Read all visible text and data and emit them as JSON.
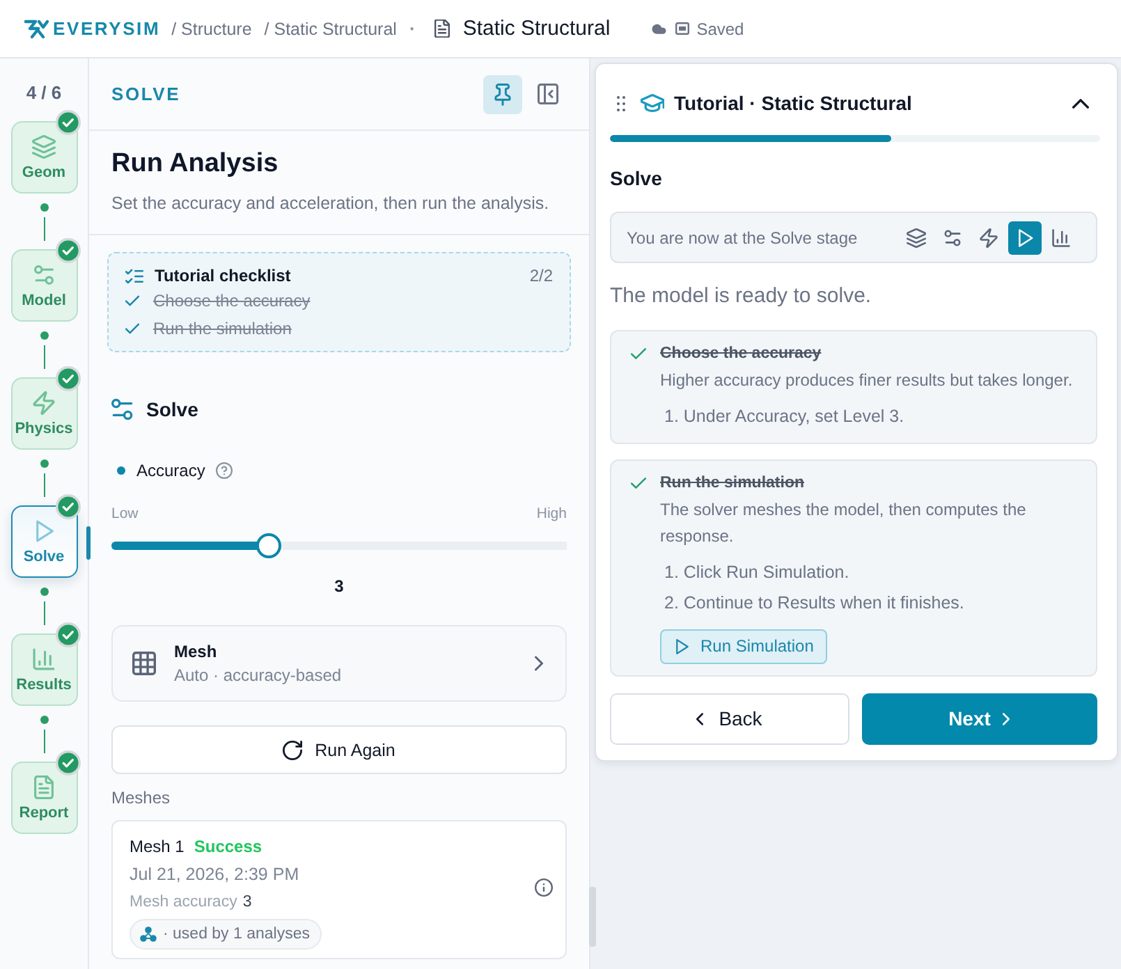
{
  "top_bar": {
    "logo": "EVERYSIM",
    "breadcrumbs": [
      "/ Structure",
      "/ Static Structural"
    ],
    "separator": "·",
    "document_title": "Static Structural",
    "save_status": "Saved"
  },
  "step_rail": {
    "progress": "4 / 6",
    "steps": [
      {
        "label": "Geom",
        "kind": "layers",
        "done": true,
        "selected": false
      },
      {
        "label": "Model",
        "kind": "sliders",
        "done": true,
        "selected": false
      },
      {
        "label": "Physics",
        "kind": "bolt",
        "done": true,
        "selected": false
      },
      {
        "label": "Solve",
        "kind": "play",
        "done": true,
        "selected": true
      },
      {
        "label": "Results",
        "kind": "chart",
        "done": true,
        "selected": false
      },
      {
        "label": "Report",
        "kind": "document",
        "done": true,
        "selected": false
      }
    ]
  },
  "solve_panel": {
    "heading": "SOLVE",
    "pinned": true,
    "title": "Run Analysis",
    "subtitle": "Set the accuracy and acceleration, then run the analysis.",
    "checklist": {
      "title": "Tutorial checklist",
      "count": "2/2",
      "items": [
        {
          "label": "Choose the accuracy",
          "done": true
        },
        {
          "label": "Run the simulation",
          "done": true
        }
      ]
    },
    "section_title": "Solve",
    "accuracy": {
      "label": "Accuracy",
      "min_label": "Low",
      "max_label": "High",
      "level": 0.345,
      "value": "3"
    },
    "mesh": {
      "title": "Mesh",
      "subtitle": "Auto · accuracy-based"
    },
    "run_button": "Run Again",
    "meshes_label": "Meshes",
    "meshes": [
      {
        "name": "Mesh 1",
        "status": "Success",
        "date": "Jul 21, 2026, 2:39 PM",
        "accuracy_label": "Mesh accuracy",
        "accuracy": "3",
        "usage": "· used by 1 analyses"
      }
    ]
  },
  "tutorial": {
    "title": "Tutorial · Static Structural",
    "expanded": true,
    "progress": {
      "level": 0.574
    },
    "stage_title": "Solve",
    "stage_bar": {
      "text": "You are now at the Solve stage",
      "stages": [
        {
          "kind": "layers",
          "selected": false
        },
        {
          "kind": "sliders",
          "selected": false
        },
        {
          "kind": "bolt",
          "selected": false
        },
        {
          "kind": "play",
          "selected": true
        },
        {
          "kind": "chart",
          "selected": false
        }
      ]
    },
    "status": "The model is ready to solve.",
    "tasks": [
      {
        "title": "Choose the accuracy",
        "done": true,
        "description": "Higher accuracy produces finer results but takes longer.",
        "steps": [
          "1. Under Accuracy, set Level 3."
        ]
      },
      {
        "title": "Run the simulation",
        "done": true,
        "description": "The solver meshes the model, then computes the response.",
        "steps": [
          "1. Click Run Simulation.",
          "2. Continue to Results when it finishes."
        ],
        "action": "Run Simulation"
      }
    ],
    "back_button": "Back",
    "next_button": "Next"
  }
}
